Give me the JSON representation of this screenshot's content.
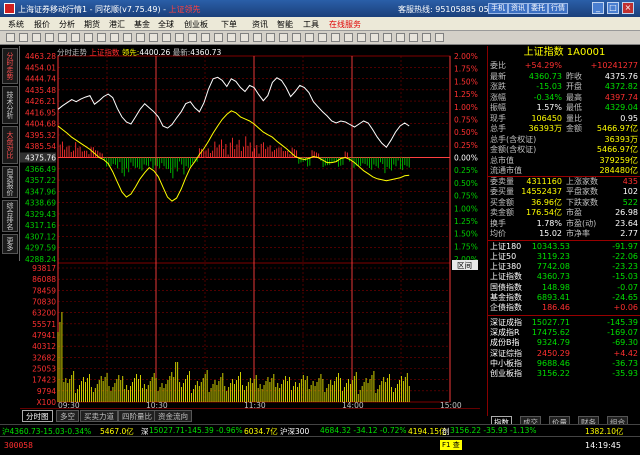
{
  "window": {
    "title_prefix": "上海证券移动行情1 - 同花顺(v7.75.49) - ",
    "title_name": "上证领先",
    "hotline": "客服热线: 95105885 0571-56768888",
    "top_buttons": [
      "手机",
      "资讯",
      "委托",
      "行情"
    ],
    "controls": [
      "_",
      "□",
      "×"
    ]
  },
  "menu": [
    {
      "label": "系统"
    },
    {
      "label": "报价"
    },
    {
      "label": "分析"
    },
    {
      "label": "期货"
    },
    {
      "label": "港汇"
    },
    {
      "label": "基金"
    },
    {
      "label": "全球"
    },
    {
      "label": "创业板"
    },
    {
      "label": "下单"
    },
    {
      "label": "资讯"
    },
    {
      "label": "智能"
    },
    {
      "label": "工具"
    },
    {
      "label": "在线服务",
      "highlight": true
    }
  ],
  "leftnav": [
    {
      "label": "分时走势",
      "red": true
    },
    {
      "label": "技术分析"
    },
    {
      "label": "大盘对比",
      "red": true
    },
    {
      "label": "自选报价"
    },
    {
      "label": "综合排名"
    },
    {
      "label": "更多"
    }
  ],
  "chart_header": {
    "tab": "分时走势",
    "name": "上证指数",
    "lead_label": "领先:",
    "lead_value": "4400.26",
    "latest_label": "最新:",
    "latest_value": "4360.73"
  },
  "chart_data": {
    "type": "line",
    "prev_close": 4375.76,
    "price_ticks": [
      "4463.28",
      "4454.01",
      "4444.74",
      "4435.48",
      "4426.21",
      "4416.95",
      "4404.68",
      "4395.32",
      "4385.54",
      "4375.76",
      "4366.49",
      "4357.22",
      "4347.96",
      "4338.69",
      "4329.43",
      "4317.16",
      "4307.12",
      "4297.59",
      "4288.24"
    ],
    "pct_ticks": [
      "2.00%",
      "1.75%",
      "1.50%",
      "1.25%",
      "1.00%",
      "0.75%",
      "0.50%",
      "0.25%",
      "0.00%",
      "0.25%",
      "0.50%",
      "0.75%",
      "1.00%",
      "1.25%",
      "1.50%",
      "1.75%",
      "2.00%"
    ],
    "volume_ticks": [
      "93817",
      "86088",
      "78459",
      "70830",
      "63200",
      "55571",
      "47941",
      "40312",
      "32682",
      "25053",
      "17423",
      "9794",
      "X100"
    ],
    "time_ticks": [
      "09:30",
      "10:30",
      "11:30",
      "14:00",
      "15:00"
    ],
    "index_label": "区间",
    "white_line": [
      0.95,
      1.02,
      1.08,
      1.14,
      1.1,
      1.15,
      1.19,
      1.22,
      1.05,
      1.12,
      1.2,
      1.25,
      1.18,
      0.97,
      0.8,
      0.7,
      0.66,
      0.8,
      0.95,
      1.06,
      0.98,
      0.9,
      0.8,
      0.62,
      0.58,
      0.65,
      0.78,
      0.9,
      1.06,
      1.1,
      0.98,
      0.9,
      1.08,
      1.35,
      1.55,
      1.58,
      1.52,
      1.4,
      1.55,
      1.5,
      1.38,
      1.3,
      1.42,
      1.38,
      1.24,
      1.12,
      1.22,
      1.48,
      1.57,
      1.52,
      1.38,
      1.2,
      1.3,
      1.42,
      1.38,
      1.28,
      1.1,
      1.0,
      0.9,
      0.82,
      0.72,
      0.68,
      0.72,
      0.7,
      0.65,
      0.6,
      0.66,
      0.72,
      0.68,
      0.55,
      0.4,
      0.28,
      0.2,
      0.34,
      0.5,
      0.62,
      0.68,
      0.62
    ],
    "yellow_line": [
      0.62,
      0.55,
      0.48,
      0.4,
      0.34,
      0.28,
      0.22,
      0.16,
      0.08,
      0.0,
      -0.04,
      -0.12,
      -0.28,
      -0.48,
      -0.68,
      -0.78,
      -0.72,
      -0.58,
      -0.42,
      -0.3,
      -0.2,
      -0.26,
      -0.38,
      -0.58,
      -0.78,
      -0.86,
      -0.8,
      -0.62,
      -0.4,
      -0.2,
      -0.08,
      0.06,
      0.18,
      0.32,
      0.48,
      0.62,
      0.75,
      0.85,
      0.92,
      0.88,
      0.8,
      0.76,
      0.72,
      0.66,
      0.58,
      0.5,
      0.45,
      0.4,
      0.32,
      0.25,
      0.18,
      0.1,
      0.02,
      -0.02,
      -0.04,
      -0.02,
      0.02,
      0.0,
      -0.05,
      -0.1,
      -0.1,
      -0.08,
      -0.02,
      0.0,
      -0.04,
      -0.1,
      -0.18,
      -0.26,
      -0.32,
      -0.38,
      -0.42,
      -0.44,
      -0.46,
      -0.44,
      -0.42,
      -0.4,
      -0.36,
      -0.35
    ]
  },
  "quote": {
    "title": "上证指数 1A0001",
    "rows1": [
      {
        "l": "委比",
        "v1": "+54.29%",
        "c1": "red",
        "l2": "",
        "v2": "+10241277",
        "c2": "red"
      },
      {
        "l": "最新",
        "v1": "4360.73",
        "c1": "grn",
        "l2": "昨收",
        "v2": "4375.76",
        "c2": "wht"
      },
      {
        "l": "涨跌",
        "v1": "-15.03",
        "c1": "grn",
        "l2": "开盘",
        "v2": "4372.82",
        "c2": "grn"
      },
      {
        "l": "涨幅",
        "v1": "-0.34%",
        "c1": "grn",
        "l2": "最高",
        "v2": "4397.74",
        "c2": "red"
      },
      {
        "l": "振幅",
        "v1": "1.57%",
        "c1": "wht",
        "l2": "最低",
        "v2": "4329.04",
        "c2": "grn"
      },
      {
        "l": "现手",
        "v1": "106450",
        "c1": "yel",
        "l2": "量比",
        "v2": "0.95",
        "c2": "wht"
      },
      {
        "l": "总手",
        "v1": "36393万",
        "c1": "yel",
        "l2": "金额",
        "v2": "5466.97亿",
        "c2": "yel"
      }
    ],
    "rows2": [
      {
        "l": "总手(含权证)",
        "v": "36393万",
        "c": "yel"
      },
      {
        "l": "金额(含权证)",
        "v": "5466.97亿",
        "c": "yel"
      },
      {
        "l": "总市值",
        "v": "379259亿",
        "c": "yel"
      },
      {
        "l": "流通市值",
        "v": "284480亿",
        "c": "yel"
      }
    ],
    "rows3": [
      {
        "l": "委卖量",
        "v1": "4311160",
        "c1": "yel",
        "l2": "上涨家数",
        "v2": "435",
        "c2": "red"
      },
      {
        "l": "委买量",
        "v1": "14552437",
        "c1": "yel",
        "l2": "平盘家数",
        "v2": "102",
        "c2": "wht"
      },
      {
        "l": "买金额",
        "v1": "36.96亿",
        "c1": "yel",
        "l2": "下跌家数",
        "v2": "522",
        "c2": "grn"
      },
      {
        "l": "卖金额",
        "v1": "176.54亿",
        "c1": "yel",
        "l2": "市盈",
        "v2": "26.98",
        "c2": "wht"
      },
      {
        "l": "换手",
        "v1": "1.78%",
        "c1": "wht",
        "l2": "市盈(动)",
        "v2": "23.64",
        "c2": "wht"
      },
      {
        "l": "均价",
        "v1": "15.02",
        "c1": "wht",
        "l2": "市净率",
        "v2": "2.77",
        "c2": "wht"
      }
    ],
    "indices1": [
      {
        "name": "上证180",
        "price": "10343.53",
        "chg": "-91.97",
        "c": "grn"
      },
      {
        "name": "上证50",
        "price": "3119.23",
        "chg": "-22.06",
        "c": "grn"
      },
      {
        "name": "上证380",
        "price": "7742.08",
        "chg": "-23.23",
        "c": "grn"
      },
      {
        "name": "上证指数",
        "price": "4360.73",
        "chg": "-15.03",
        "c": "grn"
      },
      {
        "name": "国债指数",
        "price": "148.98",
        "chg": "-0.07",
        "c": "grn"
      },
      {
        "name": "基金指数",
        "price": "6893.41",
        "chg": "-24.65",
        "c": "grn"
      },
      {
        "name": "企债指数",
        "price": "186.46",
        "chg": "+0.06",
        "c": "red"
      }
    ],
    "indices2": [
      {
        "name": "深证成指",
        "price": "15027.71",
        "chg": "-145.39",
        "c": "grn"
      },
      {
        "name": "深成指R",
        "price": "17475.62",
        "chg": "-169.07",
        "c": "grn"
      },
      {
        "name": "成份B指",
        "price": "9324.79",
        "chg": "-69.30",
        "c": "grn"
      },
      {
        "name": "深证综指",
        "price": "2450.29",
        "chg": "+4.42",
        "c": "red"
      },
      {
        "name": "中小板指",
        "price": "9688.46",
        "chg": "-36.73",
        "c": "grn"
      },
      {
        "name": "创业板指",
        "price": "3156.22",
        "chg": "-35.93",
        "c": "grn"
      }
    ]
  },
  "bottom_tabs": [
    "分时图",
    "多空",
    "买卖力道",
    "四阶量比",
    "资金流向"
  ],
  "right_tabs": [
    "指数",
    "成交",
    "价量",
    "财务",
    "组合"
  ],
  "ticker": [
    {
      "t": "沪4360.73-15.03-0.34%",
      "c": "grn"
    },
    {
      "t": "5467.0亿",
      "c": "yel"
    },
    {
      "t": "深",
      "c": "wht"
    },
    {
      "t": "15027.71-145.39 -0.96%",
      "c": "grn"
    },
    {
      "t": "6034.7亿",
      "c": "yel"
    },
    {
      "t": "沪深300",
      "c": "wht"
    },
    {
      "t": "4684.32 -34.12 -0.72%",
      "c": "grn"
    },
    {
      "t": "4194.15亿",
      "c": "yel"
    },
    {
      "t": "创",
      "c": "wht"
    },
    {
      "t": "3156.22 -35.93 -1.13%",
      "c": "grn"
    },
    {
      "t": "1382.10亿",
      "c": "yel"
    }
  ],
  "status": {
    "code": "300058",
    "qf_label": "F1 查",
    "clock": "14:19:45"
  },
  "colors": {
    "up": "#ff3030",
    "down": "#00e000",
    "grid": "#800000",
    "price_line": "#ffffff",
    "avg_line": "#ffff00"
  }
}
